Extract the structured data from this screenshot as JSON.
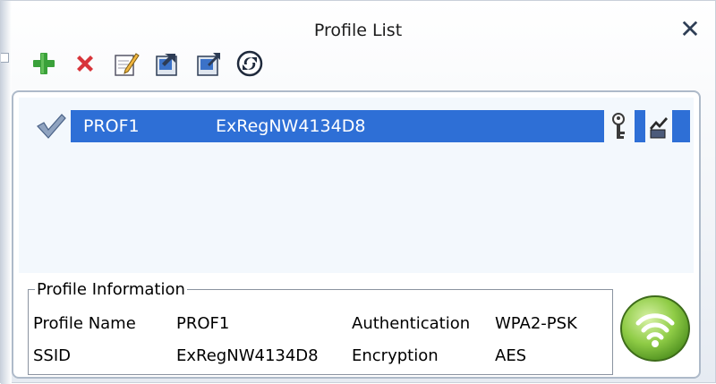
{
  "window": {
    "title": "Profile List",
    "close_symbol": "✕"
  },
  "toolbar": {
    "buttons": [
      {
        "name": "add-profile",
        "icon": "plus-icon"
      },
      {
        "name": "delete-profile",
        "icon": "delete-x-icon"
      },
      {
        "name": "edit-profile",
        "icon": "edit-pencil-icon"
      },
      {
        "name": "import-profile",
        "icon": "import-doc-icon"
      },
      {
        "name": "export-profile",
        "icon": "export-doc-icon"
      },
      {
        "name": "activate-profile",
        "icon": "refresh-circle-icon"
      }
    ]
  },
  "profiles": [
    {
      "name": "PROF1",
      "ssid": "ExRegNW4134D8",
      "selected": true,
      "secured": true,
      "icon_status": "checkmark-icon"
    }
  ],
  "profile_information": {
    "legend": "Profile Information",
    "profile_name_label": "Profile Name",
    "profile_name_value": "PROF1",
    "ssid_label": "SSID",
    "ssid_value": "ExRegNW4134D8",
    "authentication_label": "Authentication",
    "authentication_value": "WPA2-PSK",
    "encryption_label": "Encryption",
    "encryption_value": "AES"
  },
  "colors": {
    "selection": "#2e6fd6",
    "wifi_green": "#86c43a",
    "add_green": "#3aa13a",
    "delete_red": "#d8343a"
  }
}
